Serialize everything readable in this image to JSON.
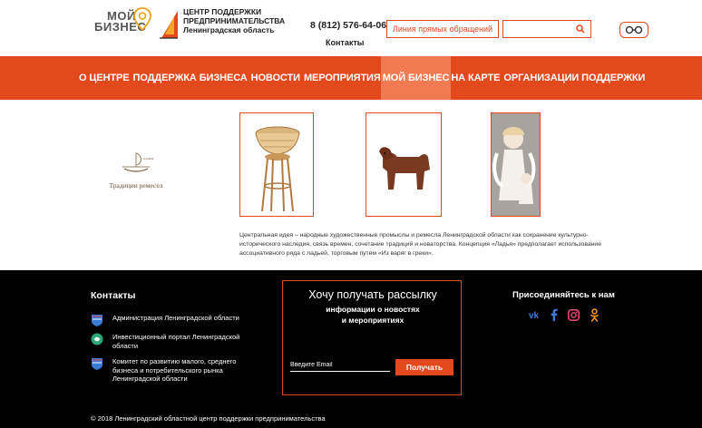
{
  "header": {
    "logo_moi_line1": "МОЙ",
    "logo_moi_line2": "БИЗНЕС",
    "logo_center": [
      "ЦЕНТР ПОДДЕРЖКИ",
      "ПРЕДПРИНИМАТЕЛЬСТВА",
      "Ленинградская область"
    ],
    "phone": "8 (812) 576-64-06",
    "contacts_label": "Контакты",
    "hotline_label": "Линия прямых обращений",
    "search_placeholder": "",
    "accessibility_icon": "glasses-icon"
  },
  "nav": {
    "items": [
      {
        "label": "О центре",
        "active": false
      },
      {
        "label": "Поддержка бизнеса",
        "active": false
      },
      {
        "label": "Новости",
        "active": false
      },
      {
        "label": "Мероприятия",
        "active": false
      },
      {
        "label": "Мой бизнес",
        "active": true
      },
      {
        "label": "на карте",
        "active": false
      },
      {
        "label": "Организации поддержки",
        "active": false
      }
    ]
  },
  "main": {
    "brand_name": "Традиции ремесел",
    "products": [
      {
        "name": "wicker-stool"
      },
      {
        "name": "clay-horse"
      },
      {
        "name": "angel-dolls"
      }
    ],
    "description": "Центральная идея – народные художественные промыслы и ремесла Ленинградской области как сохранение культурно-исторического наследия, связь времен, сочетание традиций и новаторства. Концепция «Ладья» предполагает использование ассоциативного ряда с ладьей, торговым путем «Из варяг в греки»."
  },
  "footer": {
    "contacts_title": "Контакты",
    "links": [
      {
        "label": "Администрация Ленинградской области",
        "icon": "coat-of-arms-icon"
      },
      {
        "label": "Инвестиционный портал Ленинградской области",
        "icon": "investment-portal-icon"
      },
      {
        "label": "Комитет по развитию малого, среднего бизнеса и потребительского рынка Ленинградской области",
        "icon": "coat-of-arms-icon"
      }
    ],
    "newsletter": {
      "title": "Хочу получать рассылку",
      "subtitle_line1": "информации о новостях",
      "subtitle_line2": "и мероприятиях",
      "email_placeholder": "Введите Email",
      "button_label": "Получать"
    },
    "join_title": "Присоединяйтесь к нам",
    "socials": [
      "vk-icon",
      "facebook-icon",
      "instagram-icon",
      "odnoklassniki-icon"
    ],
    "copyright": "© 2018 Ленинградский областной центр поддержки предпринимательства"
  },
  "colors": {
    "accent": "#e2491c",
    "nav_active": "#f27a52",
    "footer_bg": "#000000"
  }
}
